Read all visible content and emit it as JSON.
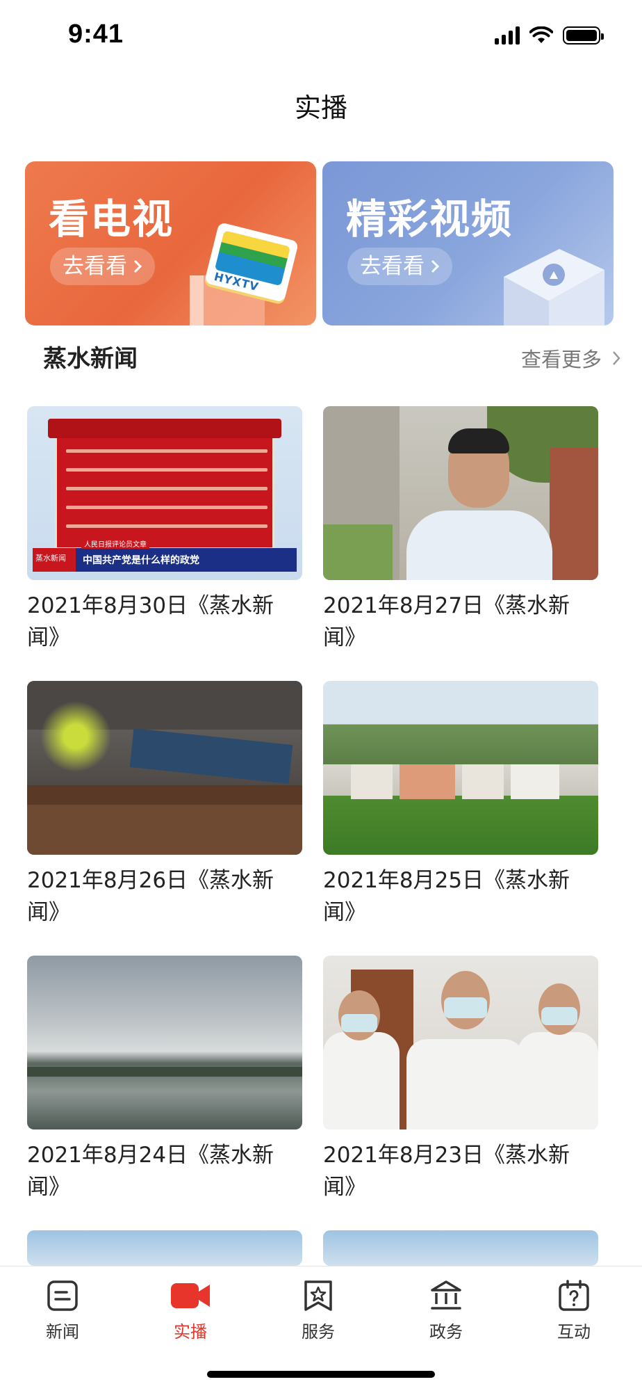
{
  "status_bar": {
    "time": "9:41"
  },
  "header": {
    "title": "实播"
  },
  "banners": [
    {
      "title": "看电视",
      "button": "去看看",
      "logo_text": "HYXTV"
    },
    {
      "title": "精彩视频",
      "button": "去看看"
    }
  ],
  "section": {
    "title": "蒸水新闻",
    "more": "查看更多"
  },
  "news_items": [
    {
      "title": "2021年8月30日《蒸水新闻》",
      "thumb_caption": "中国共产党是什么样的政党",
      "thumb_badge": "蒸水新闻",
      "thumb_subcaption": "人民日报评论员文章"
    },
    {
      "title": "2021年8月27日《蒸水新闻》"
    },
    {
      "title": "2021年8月26日《蒸水新闻》"
    },
    {
      "title": "2021年8月25日《蒸水新闻》"
    },
    {
      "title": "2021年8月24日《蒸水新闻》"
    },
    {
      "title": "2021年8月23日《蒸水新闻》"
    }
  ],
  "tab_bar": {
    "active_color": "#e8352b",
    "items": [
      {
        "label": "新闻",
        "icon": "news-icon"
      },
      {
        "label": "实播",
        "icon": "video-camera-icon",
        "active": true
      },
      {
        "label": "服务",
        "icon": "bookmark-star-icon"
      },
      {
        "label": "政务",
        "icon": "government-building-icon"
      },
      {
        "label": "互动",
        "icon": "question-calendar-icon"
      }
    ]
  }
}
